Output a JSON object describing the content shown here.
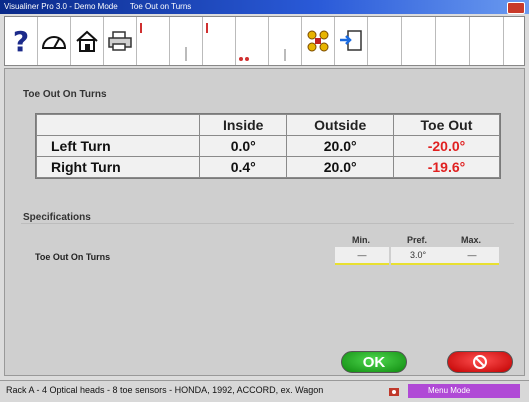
{
  "window": {
    "title": "Visualiner Pro 3.0 - Demo Mode",
    "subtitle": "Toe Out on Turns"
  },
  "toolbar": {
    "icons": [
      "help-icon",
      "gauge-icon",
      "home-icon",
      "printer-icon",
      "tool-icon-5",
      "tool-icon-6",
      "tool-icon-7",
      "tool-icon-8",
      "vehicle-specs-icon",
      "export-icon",
      "tool-icon-11",
      "tool-icon-12",
      "tool-icon-13"
    ],
    "help_glyph": "?"
  },
  "toe_out": {
    "title": "Toe Out On Turns",
    "columns": [
      "",
      "Inside",
      "Outside",
      "Toe Out"
    ],
    "rows": [
      {
        "label": "Left Turn",
        "inside": "0.0°",
        "outside": "20.0°",
        "toe_out": "-20.0°"
      },
      {
        "label": "Right Turn",
        "inside": "0.4°",
        "outside": "20.0°",
        "toe_out": "-19.6°"
      }
    ],
    "out_of_spec_color": "#e02020"
  },
  "specifications": {
    "title": "Specifications",
    "headers": {
      "min": "Min.",
      "pref": "Pref.",
      "max": "Max."
    },
    "row": {
      "label": "Toe Out On Turns",
      "min": "—",
      "pref": "3.0°",
      "max": "—"
    }
  },
  "buttons": {
    "ok_label": "OK",
    "ok_color": "#1aa81a",
    "cancel_color": "#e01010"
  },
  "status": {
    "text": "Rack A - 4 Optical heads - 8 toe sensors - HONDA, 1992, ACCORD, ex. Wagon",
    "mode": "Menu Mode",
    "mode_color": "#b04ad6"
  }
}
